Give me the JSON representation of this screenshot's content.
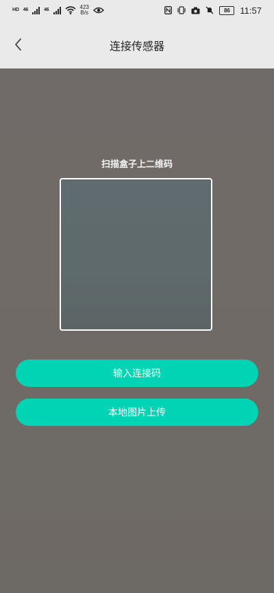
{
  "status_bar": {
    "sim1": "HD",
    "sim2": "HD",
    "net1": "46",
    "net2": "46",
    "speed_value": "423",
    "speed_unit": "B/s",
    "battery": "86",
    "time": "11:57"
  },
  "nav": {
    "title": "连接传感器"
  },
  "scan": {
    "label": "扫描盒子上二维码"
  },
  "actions": {
    "connect_code_label": "输入连接码",
    "upload_image_label": "本地图片上传"
  },
  "colors": {
    "accent": "#00d4b5",
    "topbar": "#eaeaea",
    "background": "#6f6b68"
  }
}
